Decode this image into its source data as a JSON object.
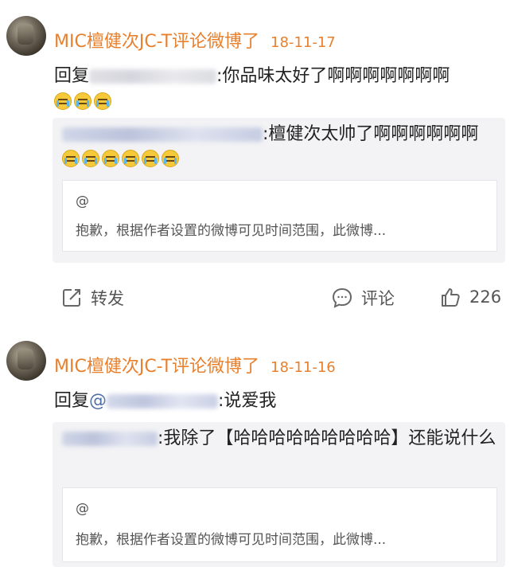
{
  "posts": [
    {
      "header": {
        "author_action": "MIC檀健次JC-T评论微博了",
        "date": "18-11-17"
      },
      "reply_prefix": "回复",
      "reply_text": ":你品味太好了啊啊啊啊啊啊啊",
      "reply_emoji_count": 3,
      "quote": {
        "text": ":檀健次太帅了啊啊啊啊啊啊",
        "emoji_count": 6,
        "inner_at": "@",
        "inner_text": "抱歉，根据作者设置的微博可见时间范围，此微博..."
      },
      "actions": {
        "repost_label": "转发",
        "comment_label": "评论",
        "like_count": "226"
      },
      "icons": [
        "repost-icon",
        "comment-icon",
        "like-icon"
      ]
    },
    {
      "header": {
        "author_action": "MIC檀健次JC-T评论微博了",
        "date": "18-11-16"
      },
      "reply_prefix": "回复",
      "reply_mention": "@",
      "reply_text": ":说爱我",
      "quote": {
        "text": ":我除了【哈哈哈哈哈哈哈哈哈】还能说什么",
        "inner_at": "@",
        "inner_text": "抱歉，根据作者设置的微博可见时间范围，此微博..."
      }
    }
  ],
  "colors": {
    "accent": "#e8802e",
    "mention": "#4f6fa8",
    "quote_bg": "#f3f3f5"
  }
}
